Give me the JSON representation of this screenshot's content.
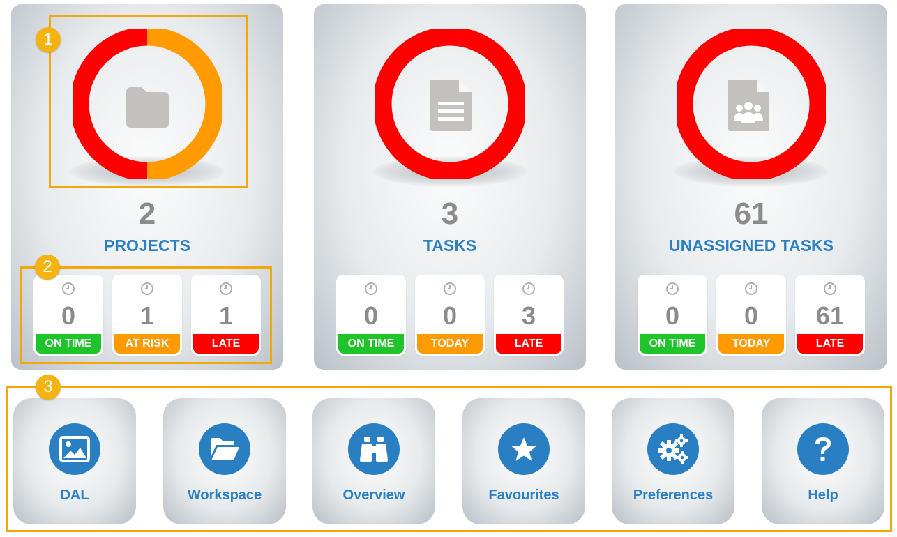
{
  "cards": [
    {
      "count": "2",
      "title": "PROJECTS",
      "stats": [
        {
          "value": "0",
          "label": "ON TIME",
          "color": "#1fc32a"
        },
        {
          "value": "1",
          "label": "AT RISK",
          "color": "#ff9a00"
        },
        {
          "value": "1",
          "label": "LATE",
          "color": "#ff0000"
        }
      ]
    },
    {
      "count": "3",
      "title": "TASKS",
      "stats": [
        {
          "value": "0",
          "label": "ON TIME",
          "color": "#1fc32a"
        },
        {
          "value": "0",
          "label": "TODAY",
          "color": "#ff9a00"
        },
        {
          "value": "3",
          "label": "LATE",
          "color": "#ff0000"
        }
      ]
    },
    {
      "count": "61",
      "title": "UNASSIGNED TASKS",
      "stats": [
        {
          "value": "0",
          "label": "ON TIME",
          "color": "#1fc32a"
        },
        {
          "value": "0",
          "label": "TODAY",
          "color": "#ff9a00"
        },
        {
          "value": "61",
          "label": "LATE",
          "color": "#ff0000"
        }
      ]
    }
  ],
  "annotations": [
    "1",
    "2",
    "3"
  ],
  "tiles": [
    {
      "label": "DAL",
      "icon": "image-icon"
    },
    {
      "label": "Workspace",
      "icon": "folder-open-icon"
    },
    {
      "label": "Overview",
      "icon": "binoculars-icon"
    },
    {
      "label": "Favourites",
      "icon": "star-icon"
    },
    {
      "label": "Preferences",
      "icon": "gears-icon"
    },
    {
      "label": "Help",
      "icon": "question-icon"
    }
  ],
  "colors": {
    "accent_blue": "#2a7fc3",
    "on_time": "#1fc32a",
    "warning": "#ff9a00",
    "late": "#ff0000",
    "annotation": "#f4b30f"
  }
}
